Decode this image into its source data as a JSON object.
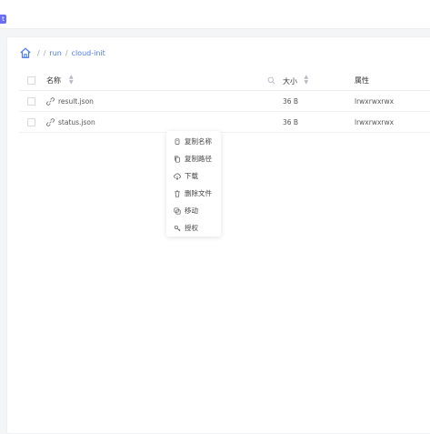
{
  "corner_tag": "t",
  "breadcrumb": {
    "separator": "/",
    "items": [
      "run",
      "cloud-init"
    ]
  },
  "table": {
    "columns": {
      "name": "名称",
      "size": "大小",
      "attributes": "属性"
    },
    "rows": [
      {
        "name": "result.json",
        "size": "36 B",
        "attributes": "lrwxrwxrwx"
      },
      {
        "name": "status.json",
        "size": "36 B",
        "attributes": "lrwxrwxrwx"
      }
    ]
  },
  "context_menu": {
    "items": [
      {
        "label": "复制名称",
        "icon": "copy-icon"
      },
      {
        "label": "复制路径",
        "icon": "copy-path-icon"
      },
      {
        "label": "下载",
        "icon": "download-icon"
      },
      {
        "label": "删除文件",
        "icon": "trash-icon"
      },
      {
        "label": "移动",
        "icon": "move-icon"
      },
      {
        "label": "授权",
        "icon": "permission-icon"
      }
    ]
  },
  "colors": {
    "accent": "#4e7ae8",
    "tag": "#6a6ef0",
    "background": "#f4f5f7"
  }
}
